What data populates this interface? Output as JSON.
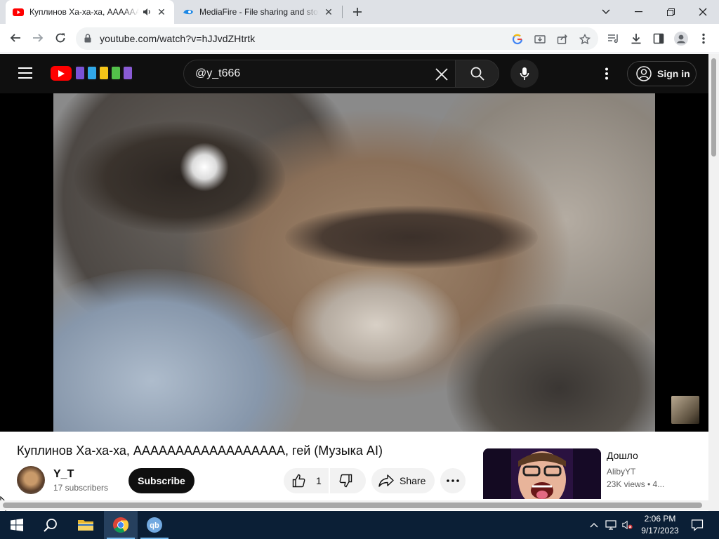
{
  "browser": {
    "tabs": [
      {
        "title": "Куплинов Ха-ха-ха, АААААА",
        "favicon": "youtube-icon",
        "active": true,
        "audio": true
      },
      {
        "title": "MediaFire - File sharing and storage",
        "favicon": "mediafire-icon",
        "active": false
      }
    ],
    "url": "youtube.com/watch?v=hJJvdZHtrtk"
  },
  "youtube": {
    "search_query": "@y_t666",
    "sign_in_label": "Sign in",
    "video": {
      "title": "Куплинов Ха-ха-ха, АААААААААААААААААА, гей (Музыка AI)",
      "channel": "Y_T",
      "subscribers": "17 subscribers",
      "subscribe_label": "Subscribe",
      "likes": "1",
      "share_label": "Share"
    },
    "recommended": [
      {
        "title": "Дошло",
        "channel": "AlibyYT",
        "meta": "23K views  • 4..."
      }
    ]
  },
  "taskbar": {
    "time": "2:06 PM",
    "date": "9/17/2023",
    "accent": "#0b1f36"
  }
}
